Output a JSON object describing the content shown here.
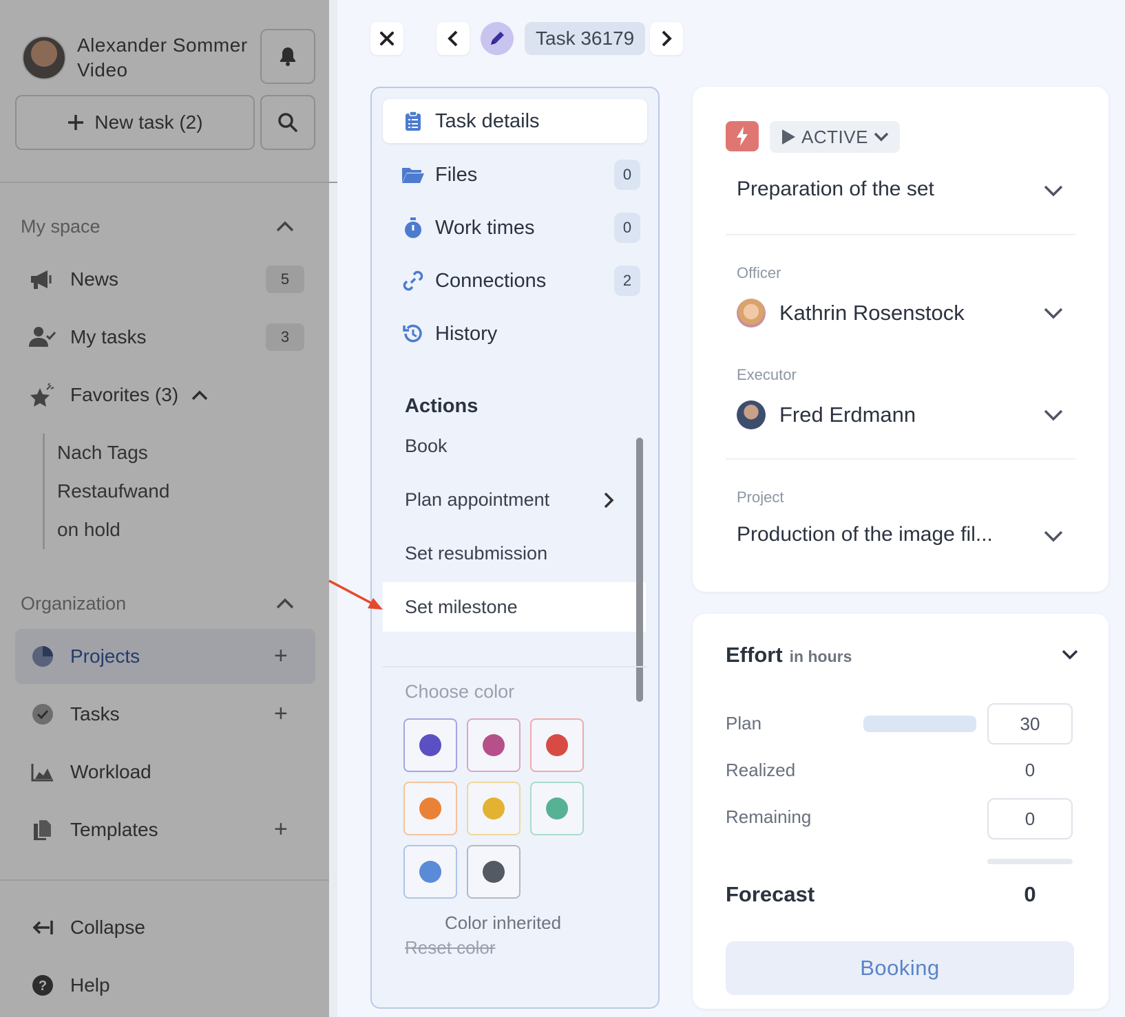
{
  "sidebar": {
    "user_name": "Alexander Sommer",
    "user_role": "Video",
    "new_task_label": "New task (2)",
    "my_space": {
      "heading": "My space",
      "items": [
        {
          "label": "News",
          "badge": "5",
          "icon": "megaphone-icon"
        },
        {
          "label": "My tasks",
          "badge": "3",
          "icon": "user-check-icon"
        },
        {
          "label": "Favorites (3)",
          "icon": "star-icon"
        }
      ],
      "favorites": [
        "Nach Tags",
        "Restaufwand",
        "on hold"
      ]
    },
    "organization": {
      "heading": "Organization",
      "items": [
        {
          "label": "Projects",
          "icon": "pie-chart-icon"
        },
        {
          "label": "Tasks",
          "icon": "check-circle-icon"
        },
        {
          "label": "Workload",
          "icon": "area-chart-icon"
        },
        {
          "label": "Templates",
          "icon": "copy-icon"
        }
      ]
    },
    "collapse_label": "Collapse",
    "help_label": "Help"
  },
  "toolbar": {
    "task_label": "Task 36179"
  },
  "tabs": [
    {
      "label": "Task details",
      "icon": "clipboard-icon"
    },
    {
      "label": "Files",
      "count": "0",
      "icon": "folder-icon"
    },
    {
      "label": "Work times",
      "count": "0",
      "icon": "stopwatch-icon"
    },
    {
      "label": "Connections",
      "count": "2",
      "icon": "link-icon"
    },
    {
      "label": "History",
      "icon": "history-icon"
    }
  ],
  "actions": {
    "title": "Actions",
    "items": [
      "Book",
      "Plan appointment",
      "Set resubmission",
      "Set milestone"
    ],
    "choose_color": "Choose color",
    "colors": [
      "#5b4fc4",
      "#b6508a",
      "#d84b44",
      "#e98236",
      "#e4b231",
      "#57b195",
      "#5a8bd6",
      "#545a63"
    ],
    "color_border_colors": [
      "#a9a4e0",
      "#dda6c5",
      "#eeaaa7",
      "#f3c49d",
      "#efd89b",
      "#a9dbcb",
      "#adc5ea",
      "#b6b9be"
    ],
    "inherited_label": "Color inherited",
    "reset_label": "Reset color"
  },
  "details": {
    "status": "ACTIVE",
    "title": "Preparation of the set",
    "officer_label": "Officer",
    "officer_name": "Kathrin Rosenstock",
    "executor_label": "Executor",
    "executor_name": "Fred Erdmann",
    "project_label": "Project",
    "project_name": "Production of the image fil..."
  },
  "effort": {
    "title": "Effort",
    "unit": "in hours",
    "plan_label": "Plan",
    "plan_value": "30",
    "realized_label": "Realized",
    "realized_value": "0",
    "remaining_label": "Remaining",
    "remaining_value": "0",
    "forecast_label": "Forecast",
    "forecast_value": "0",
    "booking_label": "Booking"
  },
  "colors": {
    "accent": "#5a84c7",
    "sidebar_overlay": "#adadad",
    "status_badge": "#e07672"
  }
}
